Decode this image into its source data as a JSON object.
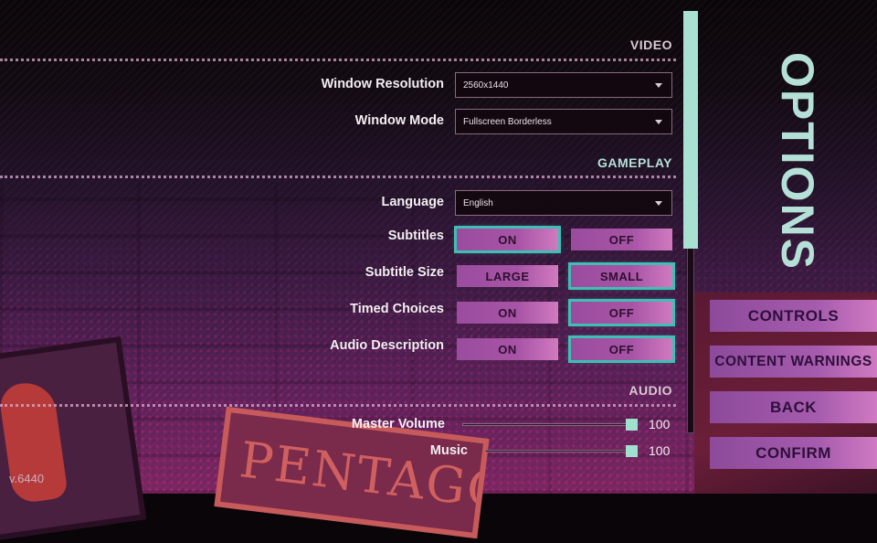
{
  "title": "OPTIONS",
  "version": "v.6440",
  "colors": {
    "accent": "#a8e0d2",
    "selected_outline": "#3fbfb4",
    "button_start": "#9a4c9e",
    "button_end": "#d07abf",
    "button_text": "#2e0f2e",
    "section_video": "#d9c9d3",
    "section_gameplay": "#b5e0d8",
    "section_audio": "#d9c9d3"
  },
  "sections": {
    "video": {
      "title": "VIDEO",
      "window_resolution": {
        "label": "Window Resolution",
        "value": "2560x1440"
      },
      "window_mode": {
        "label": "Window Mode",
        "value": "Fullscreen Borderless"
      }
    },
    "gameplay": {
      "title": "GAMEPLAY",
      "language": {
        "label": "Language",
        "value": "English"
      },
      "subtitles": {
        "label": "Subtitles",
        "options": [
          "ON",
          "OFF"
        ],
        "selected": "ON"
      },
      "subtitle_size": {
        "label": "Subtitle Size",
        "options": [
          "LARGE",
          "SMALL"
        ],
        "selected": "SMALL"
      },
      "timed_choices": {
        "label": "Timed Choices",
        "options": [
          "ON",
          "OFF"
        ],
        "selected": "OFF"
      },
      "audio_description": {
        "label": "Audio Description",
        "options": [
          "ON",
          "OFF"
        ],
        "selected": "OFF"
      }
    },
    "audio": {
      "title": "AUDIO",
      "master_volume": {
        "label": "Master Volume",
        "value": "100",
        "max": 100
      },
      "music": {
        "label": "Music",
        "value": "100",
        "max": 100
      }
    }
  },
  "side_menu": {
    "controls": "CONTROLS",
    "content_warnings": "CONTENT WARNINGS",
    "back": "BACK",
    "confirm": "CONFIRM"
  }
}
